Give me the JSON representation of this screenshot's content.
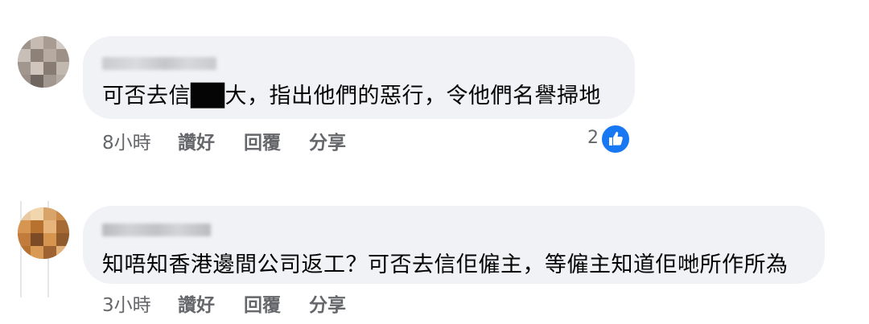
{
  "comments": [
    {
      "text": "可否去信██大，指出他們的惡行，令他們名譽掃地",
      "time": "8小時",
      "like_label": "讚好",
      "reply_label": "回覆",
      "share_label": "分享",
      "reaction_count": "2",
      "reaction_icon": "thumbs-up-icon",
      "accent": "#1877f2"
    },
    {
      "text": "知唔知香港邊間公司返工？可否去信佢僱主，等僱主知道佢哋所作所為",
      "time": "3小時",
      "like_label": "讚好",
      "reply_label": "回覆",
      "share_label": "分享"
    }
  ]
}
